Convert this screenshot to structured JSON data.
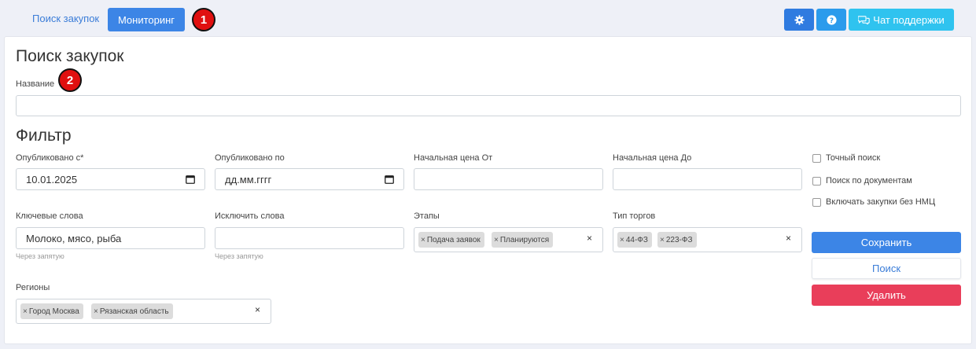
{
  "nav": {
    "search_link": "Поиск закупок",
    "monitoring_button": "Мониторинг",
    "marker1": "1",
    "marker2": "2"
  },
  "toolbar": {
    "settings_icon": "gear-icon",
    "help_icon": "question-icon",
    "chat_label": "Чат поддержки"
  },
  "page": {
    "title": "Поиск закупок",
    "name_label": "Название",
    "name_value": "",
    "filter_title": "Фильтр"
  },
  "filters": {
    "published_from_label": "Опубликовано с*",
    "published_from_value": "10.01.2025",
    "published_to_label": "Опубликовано по",
    "published_to_value": "дд.мм.гггг",
    "price_from_label": "Начальная цена От",
    "price_from_value": "",
    "price_to_label": "Начальная цена До",
    "price_to_value": "",
    "keywords_label": "Ключевые слова",
    "keywords_value": "Молоко, мясо, рыба",
    "keywords_hint": "Через запятую",
    "exclude_label": "Исключить слова",
    "exclude_value": "",
    "exclude_hint": "Через запятую",
    "stages_label": "Этапы",
    "stages_tags": [
      "Подача заявок",
      "Планируются"
    ],
    "trade_type_label": "Тип торгов",
    "trade_type_tags": [
      "44-ФЗ",
      "223-ФЗ"
    ],
    "regions_label": "Регионы",
    "regions_tags": [
      "Город Москва",
      "Рязанская область"
    ],
    "tag_remove": "×",
    "clear": "×"
  },
  "options": {
    "exact_search": "Точный поиск",
    "doc_search": "Поиск по документам",
    "no_nmc": "Включать закупки без НМЦ"
  },
  "actions": {
    "save": "Сохранить",
    "search": "Поиск",
    "delete": "Удалить"
  }
}
